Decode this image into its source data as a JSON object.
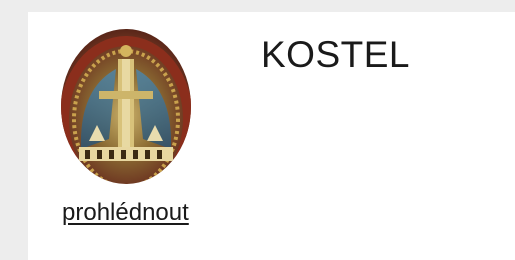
{
  "card": {
    "title": "KOSTEL",
    "link_label": "prohlédnout",
    "image": {
      "subject": "ornate church vault / stained glass detail",
      "colors": [
        "#b8913f",
        "#7d2f1c",
        "#3c6a8a",
        "#d8c27a"
      ]
    }
  }
}
